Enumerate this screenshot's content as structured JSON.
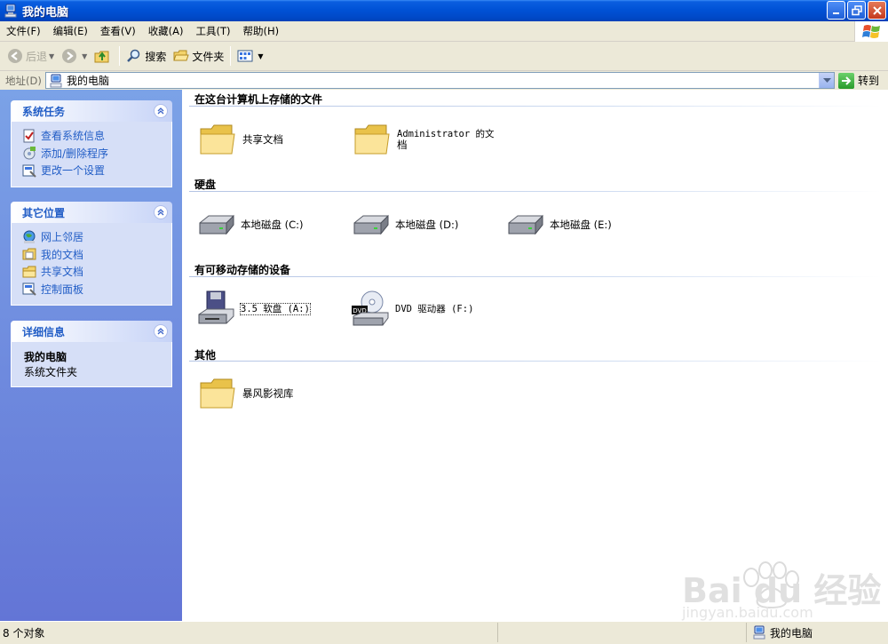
{
  "window": {
    "title": "我的电脑"
  },
  "menu": [
    "文件(F)",
    "编辑(E)",
    "查看(V)",
    "收藏(A)",
    "工具(T)",
    "帮助(H)"
  ],
  "toolbar": {
    "back": "后退",
    "search": "搜索",
    "folders": "文件夹"
  },
  "address": {
    "label": "地址(D)",
    "value": "我的电脑",
    "go": "转到"
  },
  "left": {
    "system_tasks": {
      "title": "系统任务",
      "items": [
        "查看系统信息",
        "添加/删除程序",
        "更改一个设置"
      ]
    },
    "other_places": {
      "title": "其它位置",
      "items": [
        "网上邻居",
        "我的文档",
        "共享文档",
        "控制面板"
      ]
    },
    "details": {
      "title": "详细信息",
      "name": "我的电脑",
      "type": "系统文件夹"
    }
  },
  "groups": {
    "stored": {
      "title": "在这台计算机上存储的文件",
      "items": [
        "共享文档",
        "Administrator 的文",
        "档"
      ]
    },
    "hard_disks": {
      "title": "硬盘",
      "items": [
        "本地磁盘 (C:)",
        "本地磁盘 (D:)",
        "本地磁盘 (E:)"
      ]
    },
    "removable": {
      "title": "有可移动存储的设备",
      "items": [
        "3.5 软盘 (A:)",
        "DVD 驱动器 (F:)"
      ]
    },
    "other": {
      "title": "其他",
      "items": [
        "暴风影视库"
      ]
    }
  },
  "status": {
    "count": "8 个对象",
    "location": "我的电脑"
  },
  "watermark": {
    "brand": "Bai du 经验",
    "url": "jingyan.baidu.com"
  },
  "colors": {
    "titlebar": "#0052d6",
    "chrome": "#ece9d8",
    "task_link": "#215dc6",
    "left_pane_top": "#7ba2e7",
    "left_pane_bottom": "#6375d6"
  }
}
